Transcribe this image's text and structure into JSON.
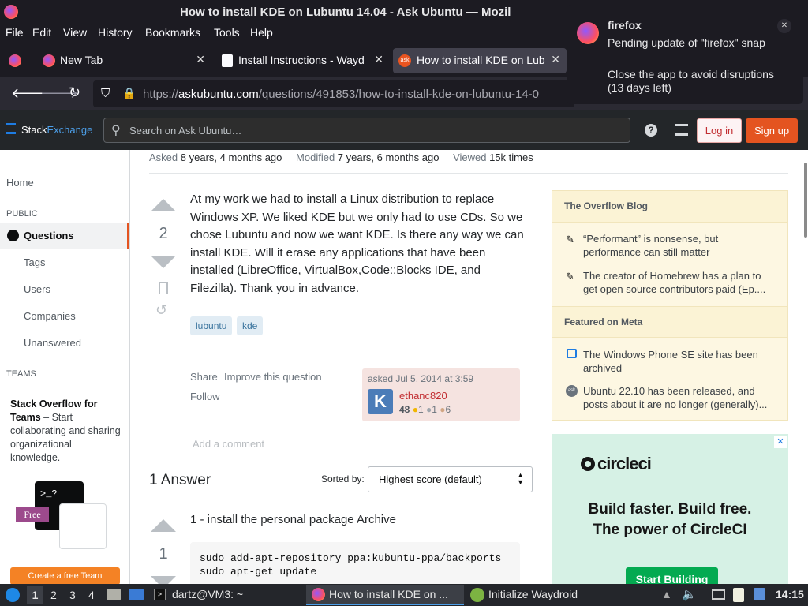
{
  "window": {
    "title": "How to install KDE on Lubuntu 14.04 - Ask Ubuntu — Mozil"
  },
  "menubar": [
    "File",
    "Edit",
    "View",
    "History",
    "Bookmarks",
    "Tools",
    "Help"
  ],
  "tabs": [
    {
      "label": "New Tab"
    },
    {
      "label": "Install Instructions - Wayd"
    },
    {
      "label": "How to install KDE on Lub"
    }
  ],
  "url": {
    "prefix": "https://",
    "domain": "askubuntu.com",
    "path": "/questions/491853/how-to-install-kde-on-lubuntu-14-0"
  },
  "se": {
    "brand_a": "Stack",
    "brand_b": "Exchange",
    "search_placeholder": "Search on Ask Ubuntu…",
    "login": "Log in",
    "signup": "Sign up"
  },
  "meta": {
    "asked_label": "Asked",
    "asked": "8 years, 4 months ago",
    "modified_label": "Modified",
    "modified": "7 years, 6 months ago",
    "viewed_label": "Viewed",
    "viewed": "15k times"
  },
  "leftnav": {
    "home": "Home",
    "public": "PUBLIC",
    "questions": "Questions",
    "tags": "Tags",
    "users": "Users",
    "companies": "Companies",
    "unanswered": "Unanswered",
    "teams": "TEAMS",
    "teams_title": "Stack Overflow for Teams",
    "teams_text": " – Start collaborating and sharing organizational knowledge.",
    "free": "Free",
    "create_team": "Create a free Team"
  },
  "question": {
    "votes": "2",
    "body": "At my work we had to install a Linux distribution to replace Windows XP. We liked KDE but we only had to use CDs. So we chose Lubuntu and now we want KDE. Is there any way we can install KDE. Will it erase any applications that have been installed (LibreOffice, VirtualBox,Code::Blocks IDE, and Filezilla). Thank you in advance.",
    "tags": [
      "lubuntu",
      "kde"
    ],
    "share": "Share",
    "improve": "Improve this question",
    "follow": "Follow",
    "asked_time": "asked Jul 5, 2014 at 3:59",
    "user": "ethanc820",
    "rep": "48",
    "gold": "1",
    "silver": "1",
    "bronze": "6",
    "add_comment": "Add a comment"
  },
  "answers": {
    "count_label": "1 Answer",
    "sorted_label": "Sorted by:",
    "sort_value": "Highest score (default)",
    "votes": "1",
    "text": "1 - install the personal package Archive",
    "code": "sudo add-apt-repository ppa:kubuntu-ppa/backports\nsudo apt-get update"
  },
  "blog": {
    "header1": "The Overflow Blog",
    "items1": [
      "“Performant” is nonsense, but performance can still matter",
      "The creator of Homebrew has a plan to get open source contributors paid (Ep...."
    ],
    "header2": "Featured on Meta",
    "items2": [
      "The Windows Phone SE site has been archived",
      "Ubuntu 22.10 has been released, and posts about it are no longer (generally)..."
    ]
  },
  "ad": {
    "brand": "circleci",
    "line1": "Build faster. Build free.",
    "line2": "The power of CircleCI",
    "cta": "Start Building"
  },
  "notification": {
    "app": "firefox",
    "line1": "Pending update of \"firefox\" snap",
    "line2": "Close the app to avoid disruptions (13 days left)"
  },
  "taskbar": {
    "ws": [
      "1",
      "2",
      "3",
      "4"
    ],
    "terminal": "dartz@VM3: ~",
    "firefox": "How to install KDE on ...",
    "waydroid": "Initialize Waydroid",
    "clock": "14:15"
  }
}
